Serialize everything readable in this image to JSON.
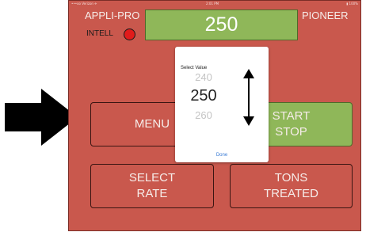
{
  "status_bar": {
    "left": "•••oo Verizon ✈",
    "center": "2:01 PM",
    "right": "▮ 100%"
  },
  "header": {
    "brand_left": "APPLI-PRO",
    "brand_right": "PIONEER",
    "intell_label": "INTELL",
    "rate_value": "250"
  },
  "buttons": {
    "menu": "MENU",
    "start": "START",
    "stop": "STOP",
    "select": "SELECT",
    "rate": "RATE",
    "tons": "TONS",
    "treated": "TREATED"
  },
  "picker": {
    "title": "Select Value",
    "prev_value": "240",
    "selected_value": "250",
    "next_value": "260",
    "done_label": "Done"
  },
  "colors": {
    "background": "#c9584d",
    "accent_green": "#8fb759",
    "indicator_red": "#e11b1b",
    "arrow": "#000000"
  },
  "icons": {
    "pointer": "right-arrow-icon",
    "scroll": "double-arrow-icon"
  }
}
